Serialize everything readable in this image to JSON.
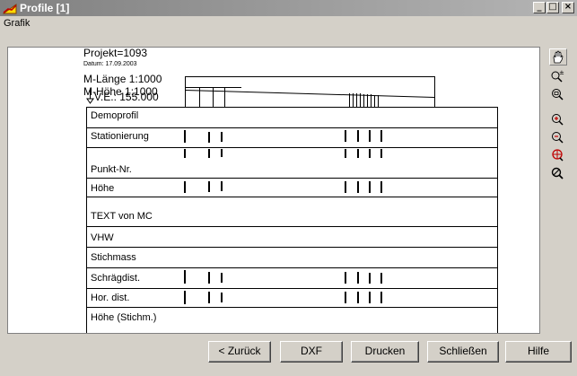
{
  "window": {
    "title": "Profile [1]",
    "controls": [
      "_",
      "□",
      "×"
    ]
  },
  "menu": [
    "Grafik"
  ],
  "header": {
    "projekt": "Projekt=1093",
    "datum": "Datum: 17.09.2003",
    "m_laenge": "M-Länge 1:1000",
    "m_hoehe": "M-Höhe 1:1000",
    "ve": "V.E.: 155.000"
  },
  "bands": [
    "Demoprofil",
    "Stationierung",
    "Punkt-Nr.",
    "Höhe",
    "TEXT von MC",
    "VHW",
    "Stichmass",
    "Schrägdist.",
    "Hor. dist.",
    "Höhe (Stichm.)"
  ],
  "toolbar": [
    {
      "icon": "hand-pan-icon"
    },
    {
      "icon": "zoom-plus-minus-icon"
    },
    {
      "icon": "zoom-window-icon"
    },
    {
      "icon": "zoom-in-icon"
    },
    {
      "icon": "zoom-out-icon"
    },
    {
      "icon": "zoom-all-icon"
    },
    {
      "icon": "zoom-previous-icon"
    }
  ],
  "buttons": {
    "back": "< Zurück",
    "dxf": "DXF",
    "print": "Drucken",
    "close": "Schließen",
    "help": "Hilfe"
  },
  "colors": {
    "titlebar_start": "#808080",
    "titlebar_end": "#b5b5b5",
    "face": "#d4d0c8"
  }
}
